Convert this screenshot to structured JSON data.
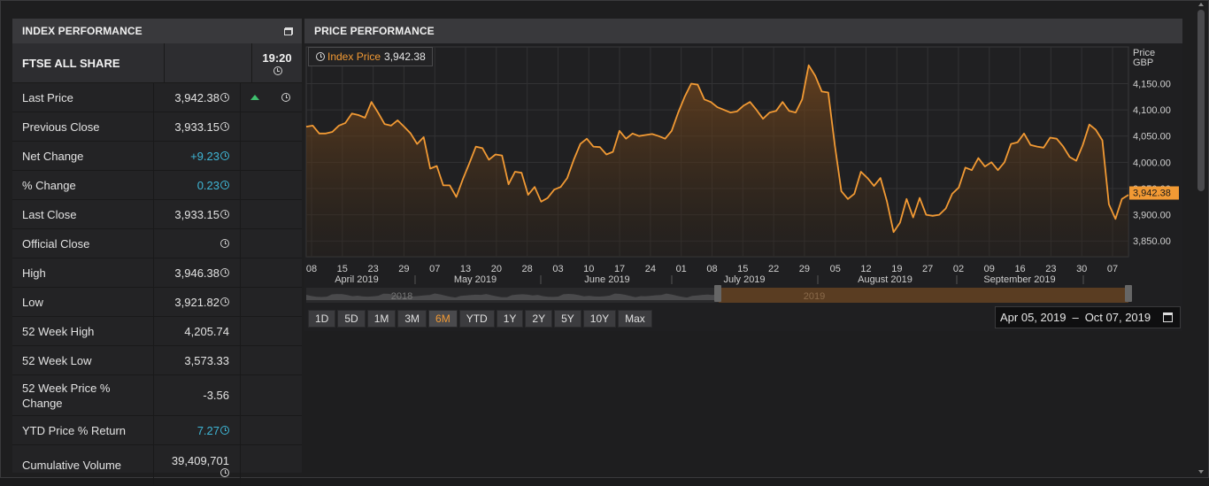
{
  "index_panel": {
    "title": "INDEX PERFORMANCE",
    "index_name": "FTSE ALL SHARE",
    "time": "19:20",
    "rows": [
      {
        "label": "Last Price",
        "value": "3,942.38",
        "clock": true,
        "positive": false,
        "arrow": "up",
        "ext_clock": true
      },
      {
        "label": "Previous Close",
        "value": "3,933.15",
        "clock": true,
        "positive": false
      },
      {
        "label": "Net Change",
        "value": "+9.23",
        "clock": true,
        "positive": true
      },
      {
        "label": "% Change",
        "value": "0.23",
        "clock": true,
        "positive": true
      },
      {
        "label": "Last Close",
        "value": "3,933.15",
        "clock": true,
        "positive": false
      },
      {
        "label": "Official Close",
        "value": "",
        "clock": true,
        "positive": false
      },
      {
        "label": "High",
        "value": "3,946.38",
        "clock": true,
        "positive": false
      },
      {
        "label": "Low",
        "value": "3,921.82",
        "clock": true,
        "positive": false
      },
      {
        "label": "52 Week High",
        "value": "4,205.74",
        "clock": false,
        "positive": false
      },
      {
        "label": "52 Week Low",
        "value": "3,573.33",
        "clock": false,
        "positive": false
      },
      {
        "label": "52 Week Price % Change",
        "value": "-3.56",
        "clock": false,
        "positive": false,
        "tall": true
      },
      {
        "label": "YTD Price % Return",
        "value": "7.27",
        "clock": true,
        "positive": true
      },
      {
        "label": "Cumulative Volume",
        "value": "39,409,701",
        "clock": true,
        "positive": false,
        "stacked": true,
        "tall": true
      }
    ]
  },
  "price_panel": {
    "title": "PRICE PERFORMANCE",
    "legend": {
      "name": "Index Price",
      "value": "3,942.38"
    },
    "ranges": [
      "1D",
      "5D",
      "1M",
      "3M",
      "6M",
      "YTD",
      "1Y",
      "2Y",
      "5Y",
      "10Y",
      "Max"
    ],
    "active_range": "6M",
    "date_from": "Apr 05, 2019",
    "date_sep": "–",
    "date_to": "Oct 07, 2019",
    "navigator_labels": [
      "2018",
      "2019"
    ]
  },
  "chart_data": {
    "type": "area",
    "series": [
      {
        "name": "Index Price",
        "color": "#f29a34",
        "values": [
          4068,
          4070,
          4055,
          4055,
          4058,
          4070,
          4075,
          4093,
          4090,
          4085,
          4115,
          4095,
          4073,
          4070,
          4080,
          4068,
          4055,
          4035,
          4048,
          3988,
          3993,
          3956,
          3956,
          3934,
          3968,
          3998,
          4030,
          4027,
          4005,
          4015,
          4013,
          3958,
          3982,
          3980,
          3938,
          3953,
          3925,
          3932,
          3948,
          3953,
          3970,
          4005,
          4035,
          4045,
          4030,
          4029,
          4015,
          4020,
          4060,
          4045,
          4055,
          4050,
          4052,
          4054,
          4050,
          4045,
          4060,
          4095,
          4125,
          4150,
          4148,
          4120,
          4115,
          4105,
          4100,
          4095,
          4097,
          4108,
          4115,
          4100,
          4083,
          4095,
          4098,
          4115,
          4098,
          4095,
          4120,
          4185,
          4165,
          4135,
          4133,
          4033,
          3945,
          3930,
          3940,
          3982,
          3970,
          3955,
          3970,
          3925,
          3867,
          3885,
          3930,
          3895,
          3932,
          3900,
          3898,
          3900,
          3912,
          3940,
          3952,
          3990,
          3985,
          4008,
          3992,
          4000,
          3985,
          4000,
          4035,
          4038,
          4055,
          4033,
          4030,
          4028,
          4047,
          4045,
          4030,
          4010,
          4003,
          4033,
          4072,
          4062,
          4042,
          3920,
          3892,
          3930,
          3938
        ]
      }
    ],
    "x_tick_labels": [
      "08",
      "15",
      "23",
      "29",
      "07",
      "13",
      "20",
      "28",
      "03",
      "10",
      "17",
      "24",
      "01",
      "08",
      "15",
      "22",
      "29",
      "05",
      "12",
      "19",
      "27",
      "02",
      "09",
      "16",
      "23",
      "30",
      "07"
    ],
    "x_month_labels": [
      "April 2019",
      "May 2019",
      "June 2019",
      "July 2019",
      "August 2019",
      "September 2019"
    ],
    "y_axis_title": "Price",
    "y_axis_unit": "GBP",
    "y_tick_labels": [
      "4,150.00",
      "4,100.00",
      "4,050.00",
      "4,000.00",
      "3,950.00",
      "3,900.00",
      "3,850.00"
    ],
    "y_ticks": [
      4150,
      4100,
      4050,
      4000,
      3950,
      3900,
      3850
    ],
    "ylim": [
      3820,
      4220
    ],
    "last_value_label": "3,942.38",
    "last_value": 3942.38,
    "grid": true
  }
}
